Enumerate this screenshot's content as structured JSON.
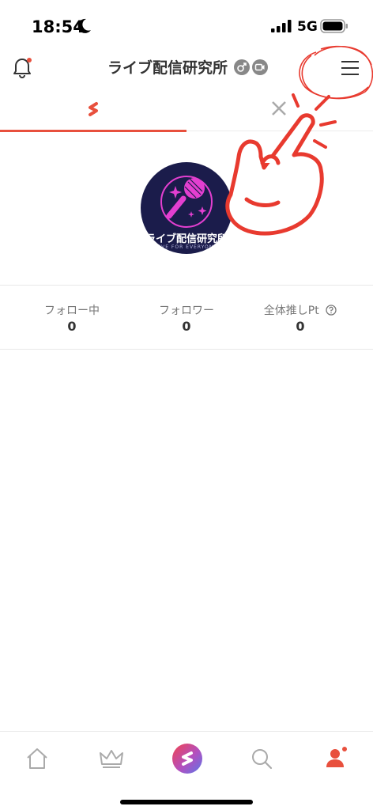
{
  "status_bar": {
    "time": "18:54",
    "network": "5G",
    "icons": [
      "moon-icon",
      "signal-bars-icon",
      "battery-icon"
    ]
  },
  "header": {
    "title": "ライブ配信研究所",
    "badges": [
      "male-symbol-icon",
      "video-camera-icon"
    ],
    "left_icon": "bell-icon",
    "right_icon": "hamburger-menu-icon"
  },
  "tabs": [
    {
      "icon": "app-logo-icon",
      "active": true
    },
    {
      "icon": "x-logo-icon",
      "active": false
    }
  ],
  "profile": {
    "avatar_name": "ライブ配信研究所",
    "avatar_tagline": "LIVE FOR EVERYONE"
  },
  "stats": [
    {
      "label": "フォロー中",
      "value": "0"
    },
    {
      "label": "フォロワー",
      "value": "0"
    },
    {
      "label": "全体推しPt",
      "value": "0",
      "icon": "question-circle-icon"
    }
  ],
  "bottom_nav": [
    {
      "icon": "home-icon"
    },
    {
      "icon": "crown-icon"
    },
    {
      "icon": "live-start-icon"
    },
    {
      "icon": "search-icon"
    },
    {
      "icon": "person-icon"
    }
  ],
  "colors": {
    "accent": "#e8503d",
    "annotation": "#e83a2f",
    "avatar_bg": "#1b1c4b",
    "mic_pink": "#e33fd0"
  }
}
